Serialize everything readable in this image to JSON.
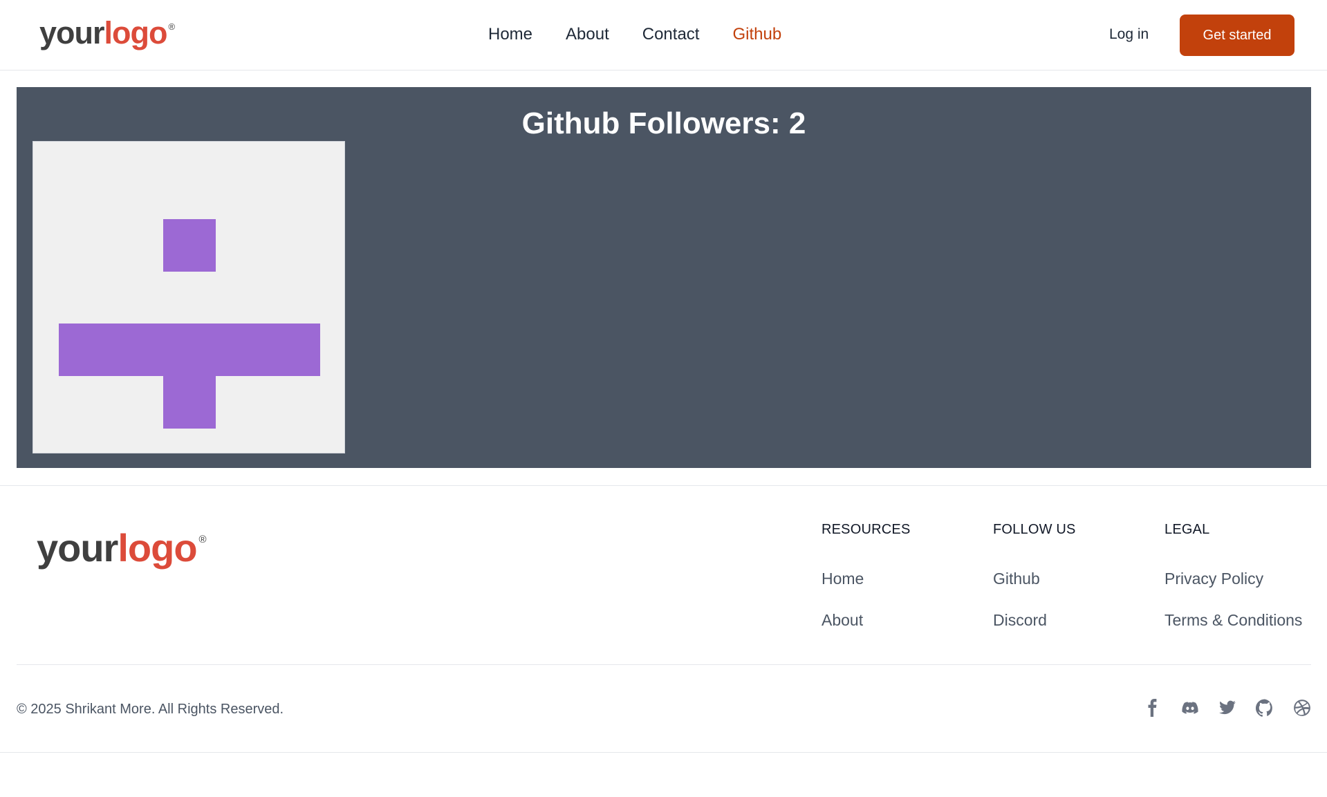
{
  "header": {
    "logo": {
      "your": "your",
      "word": "logo",
      "mark": "®"
    },
    "nav": [
      {
        "label": "Home"
      },
      {
        "label": "About"
      },
      {
        "label": "Contact"
      },
      {
        "label": "Github",
        "active": true
      }
    ],
    "login_label": "Log in",
    "cta_label": "Get started"
  },
  "main": {
    "title": "Github Followers: 2",
    "identicon_color": "#9c69d4",
    "identicon_background": "#f0f0f0"
  },
  "footer": {
    "logo": {
      "your": "your",
      "word": "logo",
      "mark": "®"
    },
    "columns": [
      {
        "heading": "RESOURCES",
        "links": [
          "Home",
          "About"
        ]
      },
      {
        "heading": "FOLLOW US",
        "links": [
          "Github",
          "Discord"
        ]
      },
      {
        "heading": "LEGAL",
        "links": [
          "Privacy Policy",
          "Terms & Conditions"
        ]
      }
    ],
    "copyright": "© 2025  Shrikant More. All Rights Reserved.",
    "socials": [
      "facebook-icon",
      "discord-icon",
      "twitter-icon",
      "github-icon",
      "dribbble-icon"
    ]
  },
  "colors": {
    "accent": "#c2410c",
    "panel": "#4b5563",
    "logo_red": "#dc4b3a"
  }
}
